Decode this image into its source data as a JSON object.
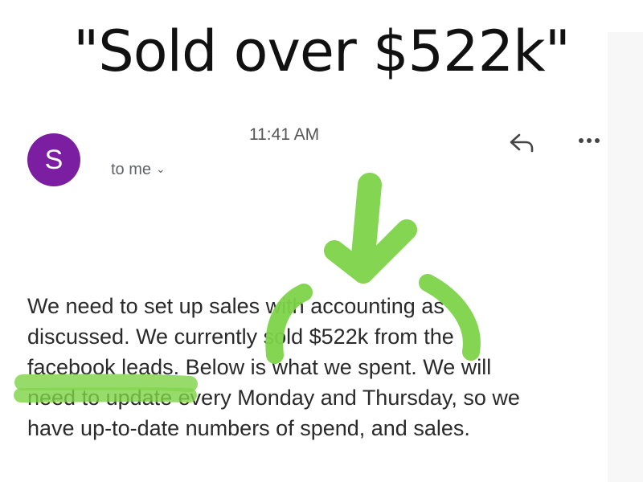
{
  "headline": "\"Sold over $522k\"",
  "email": {
    "sender_initial": "S",
    "time": "11:41 AM",
    "recipient": "to me",
    "body_lines": [
      "We need to set up sales with accounting as",
      "discussed.  We currently sold $522k from the",
      "facebook leads.  Below is what we spent.  We will",
      "need to update every Monday and Thursday, so we",
      "have up-to-date numbers of spend, and sales."
    ]
  },
  "icons": {
    "reply": "reply-arrow-icon",
    "more": "more-horizontal-icon",
    "chevron": "chevron-down-icon"
  },
  "colors": {
    "avatar": "#7b1ea2",
    "highlight": "#7ed348",
    "text": "#2a2a2a"
  }
}
